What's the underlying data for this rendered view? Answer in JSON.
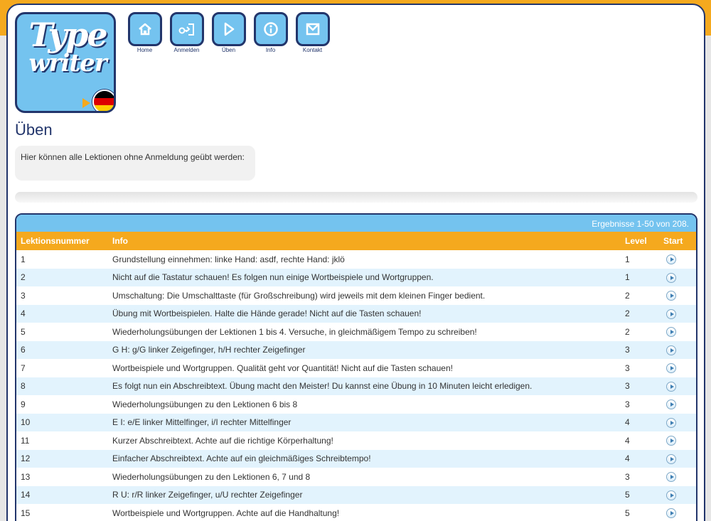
{
  "logo": {
    "line1": "Type",
    "line2": "writer"
  },
  "nav": [
    {
      "label": "Home",
      "icon": "home-icon"
    },
    {
      "label": "Anmelden",
      "icon": "login-icon"
    },
    {
      "label": "Üben",
      "icon": "play-icon"
    },
    {
      "label": "Info",
      "icon": "info-icon"
    },
    {
      "label": "Kontakt",
      "icon": "mail-icon"
    }
  ],
  "page": {
    "title": "Üben",
    "intro": "Hier können alle Lektionen ohne Anmeldung geübt werden:"
  },
  "table": {
    "results": "Ergebnisse 1-50 von 208.",
    "headers": {
      "num": "Lektionsnummer",
      "info": "Info",
      "level": "Level",
      "start": "Start"
    },
    "rows": [
      {
        "num": "1",
        "info": "Grundstellung einnehmen: linke Hand: asdf, rechte Hand: jklö",
        "level": "1"
      },
      {
        "num": "2",
        "info": "Nicht auf die Tastatur schauen! Es folgen nun einige Wortbeispiele und Wortgruppen.",
        "level": "1"
      },
      {
        "num": "3",
        "info": "Umschaltung: Die Umschalttaste (für Großschreibung) wird jeweils mit dem kleinen Finger bedient.",
        "level": "2"
      },
      {
        "num": "4",
        "info": "Übung mit Wortbeispielen. Halte die Hände gerade! Nicht auf die Tasten schauen!",
        "level": "2"
      },
      {
        "num": "5",
        "info": "Wiederholungsübungen der Lektionen 1 bis 4. Versuche, in gleichmäßigem Tempo zu schreiben!",
        "level": "2"
      },
      {
        "num": "6",
        "info": "G H: g/G linker Zeigefinger, h/H rechter Zeigefinger",
        "level": "3"
      },
      {
        "num": "7",
        "info": "Wortbeispiele und Wortgruppen. Qualität geht vor Quantität! Nicht auf die Tasten schauen!",
        "level": "3"
      },
      {
        "num": "8",
        "info": "Es folgt nun ein Abschreibtext. Übung macht den Meister! Du kannst eine Übung in 10 Minuten leicht erledigen.",
        "level": "3"
      },
      {
        "num": "9",
        "info": "Wiederholungsübungen zu den Lektionen 6 bis 8",
        "level": "3"
      },
      {
        "num": "10",
        "info": "E I: e/E linker Mittelfinger, i/I rechter Mittelfinger",
        "level": "4"
      },
      {
        "num": "11",
        "info": "Kurzer Abschreibtext. Achte auf die richtige Körperhaltung!",
        "level": "4"
      },
      {
        "num": "12",
        "info": "Einfacher Abschreibtext. Achte auf ein gleichmäßiges Schreibtempo!",
        "level": "4"
      },
      {
        "num": "13",
        "info": "Wiederholungsübungen zu den Lektionen 6, 7 und 8",
        "level": "3"
      },
      {
        "num": "14",
        "info": "R U: r/R linker Zeigefinger, u/U rechter Zeigefinger",
        "level": "5"
      },
      {
        "num": "15",
        "info": "Wortbeispiele und Wortgruppen. Achte auf die Handhaltung!",
        "level": "5"
      }
    ]
  }
}
